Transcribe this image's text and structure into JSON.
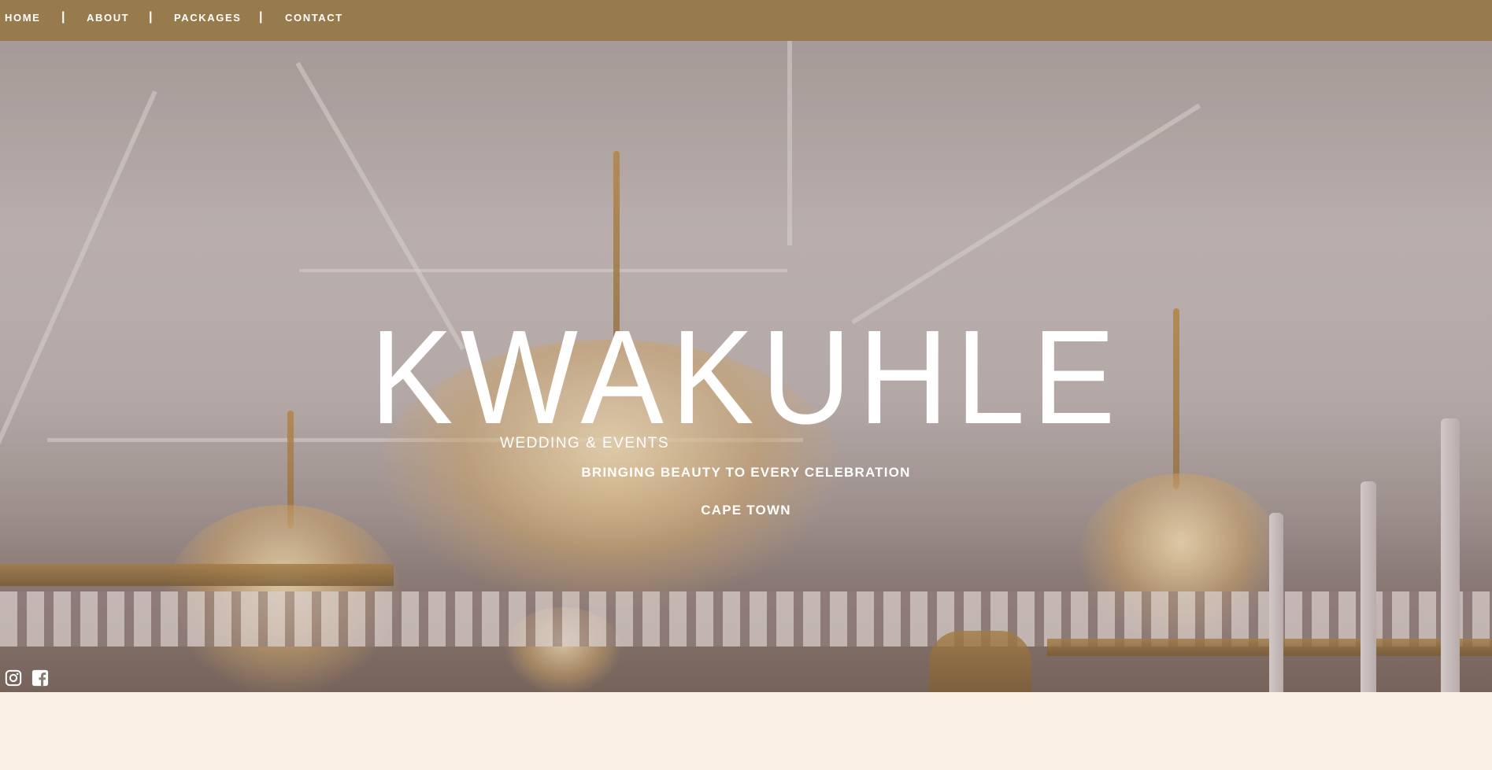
{
  "nav": {
    "items": [
      {
        "label": "HOME"
      },
      {
        "label": "ABOUT"
      },
      {
        "label": "PACKAGES"
      },
      {
        "label": "CONTACT"
      }
    ],
    "separator": "|"
  },
  "hero": {
    "logo_text": "KWAKUHLE",
    "logo_subtitle": "WEDDING & EVENTS",
    "tagline": "BRINGING BEAUTY TO EVERY CELEBRATION",
    "location": "CAPE TOWN"
  },
  "social": {
    "icons": [
      "instagram-icon",
      "facebook-icon"
    ]
  },
  "colors": {
    "nav_bg": "#977b4d",
    "page_bg": "#faf0e6",
    "text": "#ffffff"
  }
}
